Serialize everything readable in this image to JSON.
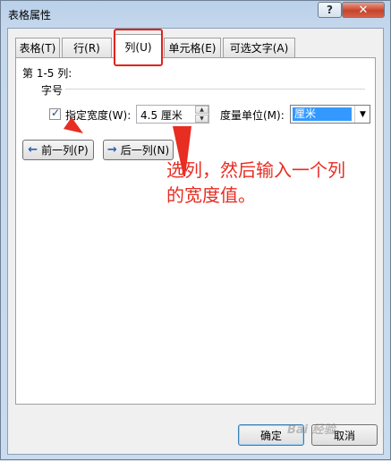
{
  "window": {
    "title": "表格属性",
    "help_label": "?",
    "close_label": "✕"
  },
  "tabs": [
    {
      "label": "表格(T)",
      "active": false
    },
    {
      "label": "行(R)",
      "active": false
    },
    {
      "label": "列(U)",
      "active": true
    },
    {
      "label": "单元格(E)",
      "active": false
    },
    {
      "label": "可选文字(A)",
      "active": false
    }
  ],
  "column_panel": {
    "range_label": "第 1-5 列:",
    "group_label": "字号",
    "specify_width_label": "指定宽度(W):",
    "specify_width_checked": true,
    "width_value": "4.5 厘米",
    "measure_unit_label": "度量单位(M):",
    "measure_unit_value": "厘米",
    "prev_column_button": "前一列(P)",
    "next_column_button": "后一列(N)"
  },
  "footer": {
    "ok_button": "确定",
    "cancel_button": "取消"
  },
  "annotation": {
    "line1": "选列，然后输入一个列",
    "line2": "的宽度值。"
  },
  "icons": {
    "prev_arrow": "left-arrow-icon",
    "next_arrow": "right-arrow-icon"
  },
  "colors": {
    "annotation_red": "#e82d22",
    "selection_blue": "#3399ff"
  }
}
